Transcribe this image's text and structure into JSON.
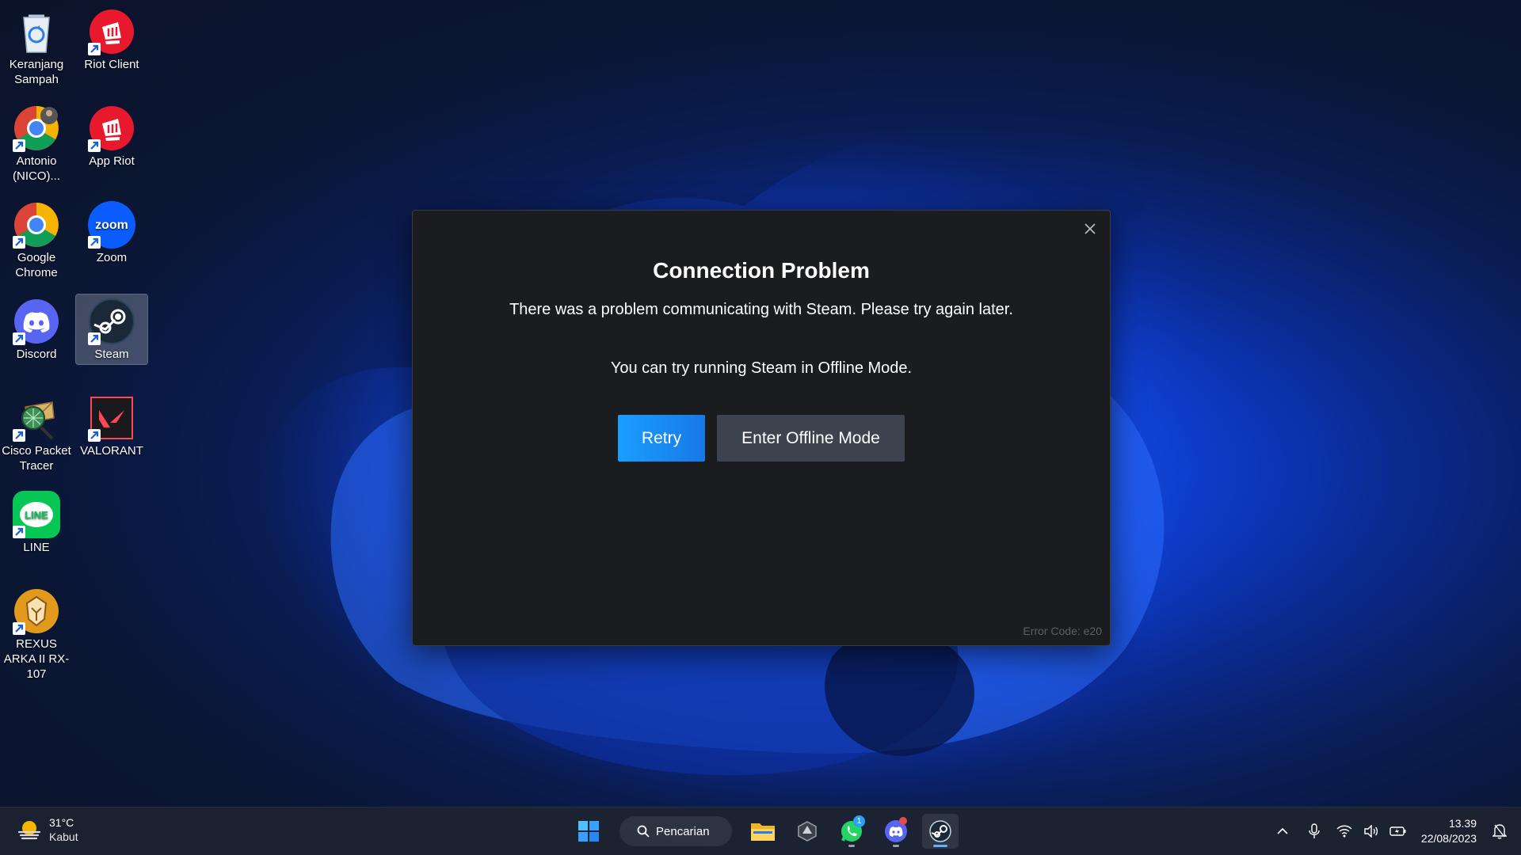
{
  "desktop": {
    "icons": [
      {
        "label": "Keranjang Sampah",
        "icon": "recycle-bin-icon"
      },
      {
        "label": "Riot Client",
        "icon": "riot-client-icon"
      },
      {
        "label": "Antonio (NICO)...",
        "icon": "chrome-profile-icon"
      },
      {
        "label": "App Riot",
        "icon": "riot-client-icon"
      },
      {
        "label": "Google Chrome",
        "icon": "chrome-icon"
      },
      {
        "label": "Zoom",
        "icon": "zoom-icon"
      },
      {
        "label": "Discord",
        "icon": "discord-icon"
      },
      {
        "label": "Steam",
        "icon": "steam-icon"
      },
      {
        "label": "Cisco Packet Tracer",
        "icon": "packet-tracer-icon"
      },
      {
        "label": "VALORANT",
        "icon": "valorant-icon"
      },
      {
        "label": "LINE",
        "icon": "line-icon"
      },
      {
        "label": "REXUS ARKA II RX-107",
        "icon": "rexus-icon"
      }
    ],
    "zoom_text": "zoom",
    "line_text": "LINE"
  },
  "dialog": {
    "title": "Connection Problem",
    "message": "There was a problem communicating with Steam. Please try again later.",
    "hint": "You can try running Steam in Offline Mode.",
    "retry_label": "Retry",
    "offline_label": "Enter Offline Mode",
    "error_code": "Error Code: e20"
  },
  "taskbar": {
    "weather_temp": "31°C",
    "weather_desc": "Kabut",
    "search_label": "Pencarian",
    "whatsapp_badge": "1",
    "time": "13.39",
    "date": "22/08/2023"
  },
  "colors": {
    "accent": "#1a9fff",
    "dialog_bg": "#1b1c1f",
    "offline_btn": "#3d4450"
  }
}
